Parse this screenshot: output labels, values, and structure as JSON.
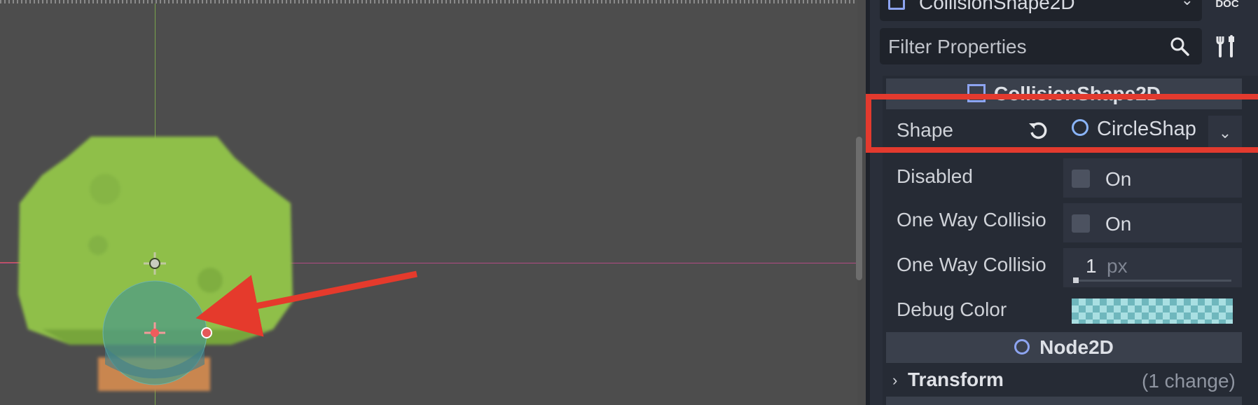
{
  "node_selector": {
    "label": "CollisionShape2D"
  },
  "doc_button": {
    "label": "DOC"
  },
  "filter": {
    "placeholder": "Filter Properties"
  },
  "section_collision": {
    "label": "CollisionShape2D"
  },
  "properties": {
    "shape": {
      "label": "Shape",
      "value": "CircleShap"
    },
    "disabled": {
      "label": "Disabled",
      "toggle_label": "On"
    },
    "one_way_collision": {
      "label": "One Way Collisio",
      "toggle_label": "On"
    },
    "one_way_margin": {
      "label": "One Way Collisio",
      "value": "1",
      "unit": "px"
    },
    "debug_color": {
      "label": "Debug Color"
    }
  },
  "section_node2d": {
    "label": "Node2D"
  },
  "transform": {
    "label": "Transform",
    "change_note": "(1 change)"
  },
  "colors": {
    "highlight": "#e33a2e",
    "accent_blue": "#8da4f0",
    "viewport_bg": "#4d4d4d",
    "dock_bg": "#262b35"
  },
  "icons": [
    "search-icon",
    "tools-icon",
    "revert-icon",
    "chevron-down-icon",
    "chevron-right-icon",
    "circle-shape-icon",
    "node-square-icon"
  ]
}
